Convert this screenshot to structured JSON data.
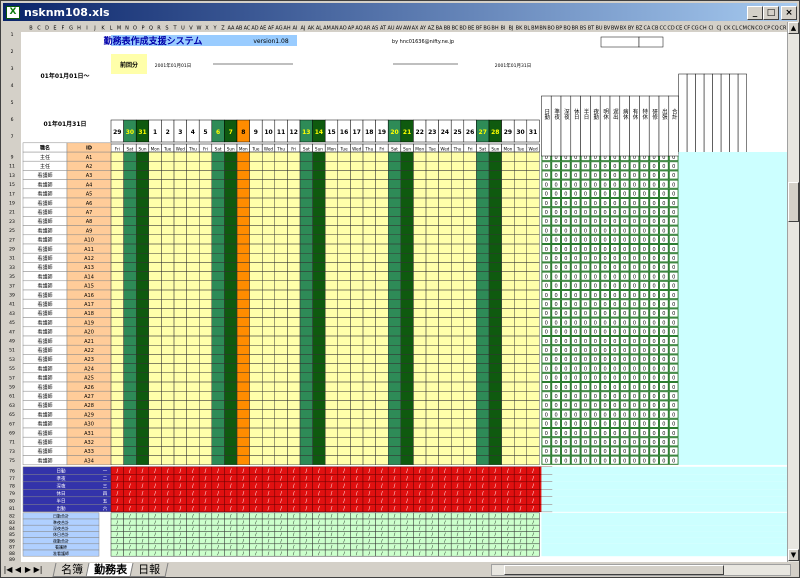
{
  "window": {
    "title": "nsknm108.xls"
  },
  "sheet": {
    "app_title": "勤務表作成支援システム",
    "version": "version1.08",
    "author": "by hnc01636@nifty.ne.jp",
    "date_from": "01年01月01日～",
    "date_to": "01年01月31日",
    "prev_period_label": "前回分",
    "range_start": "2001年01月01日",
    "range_end": "2001年01月31日",
    "name_header": "職名",
    "id_header": "ID",
    "zero": "0",
    "slash": "/",
    "col_letters": [
      "B",
      "C",
      "D",
      "E",
      "F",
      "G",
      "H",
      "I",
      "J",
      "K",
      "L",
      "M",
      "N",
      "O",
      "P",
      "Q",
      "R",
      "S",
      "T",
      "U",
      "V",
      "W",
      "X",
      "Y",
      "Z",
      "AA",
      "AB",
      "AC",
      "AD",
      "AE",
      "AF",
      "AG",
      "AH",
      "AI",
      "AJ",
      "AK",
      "AL",
      "AM",
      "AN",
      "AO",
      "AP",
      "AQ",
      "AR",
      "AS",
      "AT",
      "AU",
      "AV",
      "AW",
      "AX",
      "AY",
      "AZ",
      "BA",
      "BB",
      "BC",
      "BD",
      "BE",
      "BF",
      "BG",
      "BH",
      "BI",
      "BJ",
      "BK",
      "BL",
      "BM",
      "BN",
      "BO",
      "BP",
      "BQ",
      "BR",
      "BS",
      "BT",
      "BU",
      "BV",
      "BW",
      "BX",
      "BY",
      "BZ",
      "CA",
      "CB",
      "CC",
      "CD",
      "CE",
      "CF",
      "CG",
      "CH",
      "CI",
      "CJ",
      "CK",
      "CL",
      "CM",
      "CN",
      "CO",
      "CP",
      "CQ",
      "CR",
      "CS",
      "CT"
    ],
    "day_numbers": [
      "29",
      "30",
      "31",
      "1",
      "2",
      "3",
      "4",
      "5",
      "6",
      "7",
      "8",
      "9",
      "10",
      "11",
      "12",
      "13",
      "14",
      "15",
      "16",
      "17",
      "18",
      "19",
      "20",
      "21",
      "22",
      "23",
      "24",
      "25",
      "26",
      "27",
      "28",
      "29",
      "30",
      "31"
    ],
    "weekdays": [
      "Fri",
      "Sat",
      "Sun",
      "Mon",
      "Tue",
      "Wed",
      "Thu",
      "Fri",
      "Sat",
      "Sun",
      "Mon",
      "Tue",
      "Wed",
      "Thu",
      "Fri",
      "Sat",
      "Sun",
      "Mon",
      "Tue",
      "Wed",
      "Thu",
      "Fri",
      "Sat",
      "Sun",
      "Mon",
      "Tue",
      "Wed",
      "Thu",
      "Fri",
      "Sat",
      "Sun",
      "Mon",
      "Tue",
      "Wed"
    ],
    "summary_headers": [
      "日勤",
      "準夜",
      "深夜",
      "休日",
      "半日",
      "夜勤",
      "明休",
      "遅出",
      "病休",
      "有休",
      "特休",
      "研修",
      "出張",
      "合計"
    ],
    "row_numbers": [
      "1",
      "2",
      "3",
      "4",
      "5",
      "6",
      "7",
      "9",
      "11",
      "13",
      "15",
      "17",
      "19",
      "21",
      "23",
      "25",
      "27",
      "29",
      "31",
      "33",
      "35",
      "37",
      "39",
      "41",
      "43",
      "45",
      "47",
      "49",
      "51",
      "53",
      "55",
      "57",
      "59",
      "61",
      "63",
      "65",
      "67",
      "69",
      "71",
      "73",
      "75",
      "76",
      "77",
      "78",
      "79",
      "80",
      "81",
      "82",
      "83",
      "84",
      "85",
      "86",
      "87",
      "88",
      "89",
      "90",
      "91",
      "92",
      "93"
    ],
    "staff": [
      {
        "title": "主任",
        "id": "A1"
      },
      {
        "title": "主任",
        "id": "A2"
      },
      {
        "title": "看護師",
        "id": "A3"
      },
      {
        "title": "看護師",
        "id": "A4"
      },
      {
        "title": "看護師",
        "id": "A5"
      },
      {
        "title": "看護師",
        "id": "A6"
      },
      {
        "title": "看護師",
        "id": "A7"
      },
      {
        "title": "看護師",
        "id": "A8"
      },
      {
        "title": "看護師",
        "id": "A9"
      },
      {
        "title": "看護師",
        "id": "A10"
      },
      {
        "title": "看護師",
        "id": "A11"
      },
      {
        "title": "看護師",
        "id": "A12"
      },
      {
        "title": "看護師",
        "id": "A13"
      },
      {
        "title": "看護師",
        "id": "A14"
      },
      {
        "title": "看護師",
        "id": "A15"
      },
      {
        "title": "看護師",
        "id": "A16"
      },
      {
        "title": "看護師",
        "id": "A17"
      },
      {
        "title": "看護師",
        "id": "A18"
      },
      {
        "title": "看護師",
        "id": "A19"
      },
      {
        "title": "看護師",
        "id": "A20"
      },
      {
        "title": "看護師",
        "id": "A21"
      },
      {
        "title": "看護師",
        "id": "A22"
      },
      {
        "title": "看護師",
        "id": "A23"
      },
      {
        "title": "看護師",
        "id": "A24"
      },
      {
        "title": "看護師",
        "id": "A25"
      },
      {
        "title": "看護師",
        "id": "A26"
      },
      {
        "title": "看護師",
        "id": "A27"
      },
      {
        "title": "看護師",
        "id": "A28"
      },
      {
        "title": "看護師",
        "id": "A29"
      },
      {
        "title": "看護師",
        "id": "A30"
      },
      {
        "title": "看護師",
        "id": "A31"
      },
      {
        "title": "看護師",
        "id": "A32"
      },
      {
        "title": "看護師",
        "id": "A33"
      },
      {
        "title": "看護師",
        "id": "A34"
      }
    ],
    "shift_rows": [
      {
        "label": "日勤",
        "code": "一"
      },
      {
        "label": "準夜",
        "code": "二"
      },
      {
        "label": "深夜",
        "code": "三"
      },
      {
        "label": "休日",
        "code": "四"
      },
      {
        "label": "半日",
        "code": "五"
      },
      {
        "label": "出勤",
        "code": "六"
      }
    ],
    "count_rows": [
      "日勤合計",
      "準夜合計",
      "深夜合計",
      "休日合計",
      "夜勤合計",
      "看護師",
      "准看護師",
      "助手",
      "合計",
      "備考",
      "その他",
      "計"
    ]
  },
  "tabs": [
    {
      "label": "名簿"
    },
    {
      "label": "勤務表"
    },
    {
      "label": "日報"
    }
  ],
  "colors": {
    "green": "#1e6e1e",
    "dark_green": "#0f5a0f",
    "yellow": "#ffffaa",
    "orange": "#ff8c00",
    "red": "#e01010",
    "grid_green": "#2e7d32",
    "cyan": "#ccffff",
    "salmon": "#ffcc99"
  }
}
